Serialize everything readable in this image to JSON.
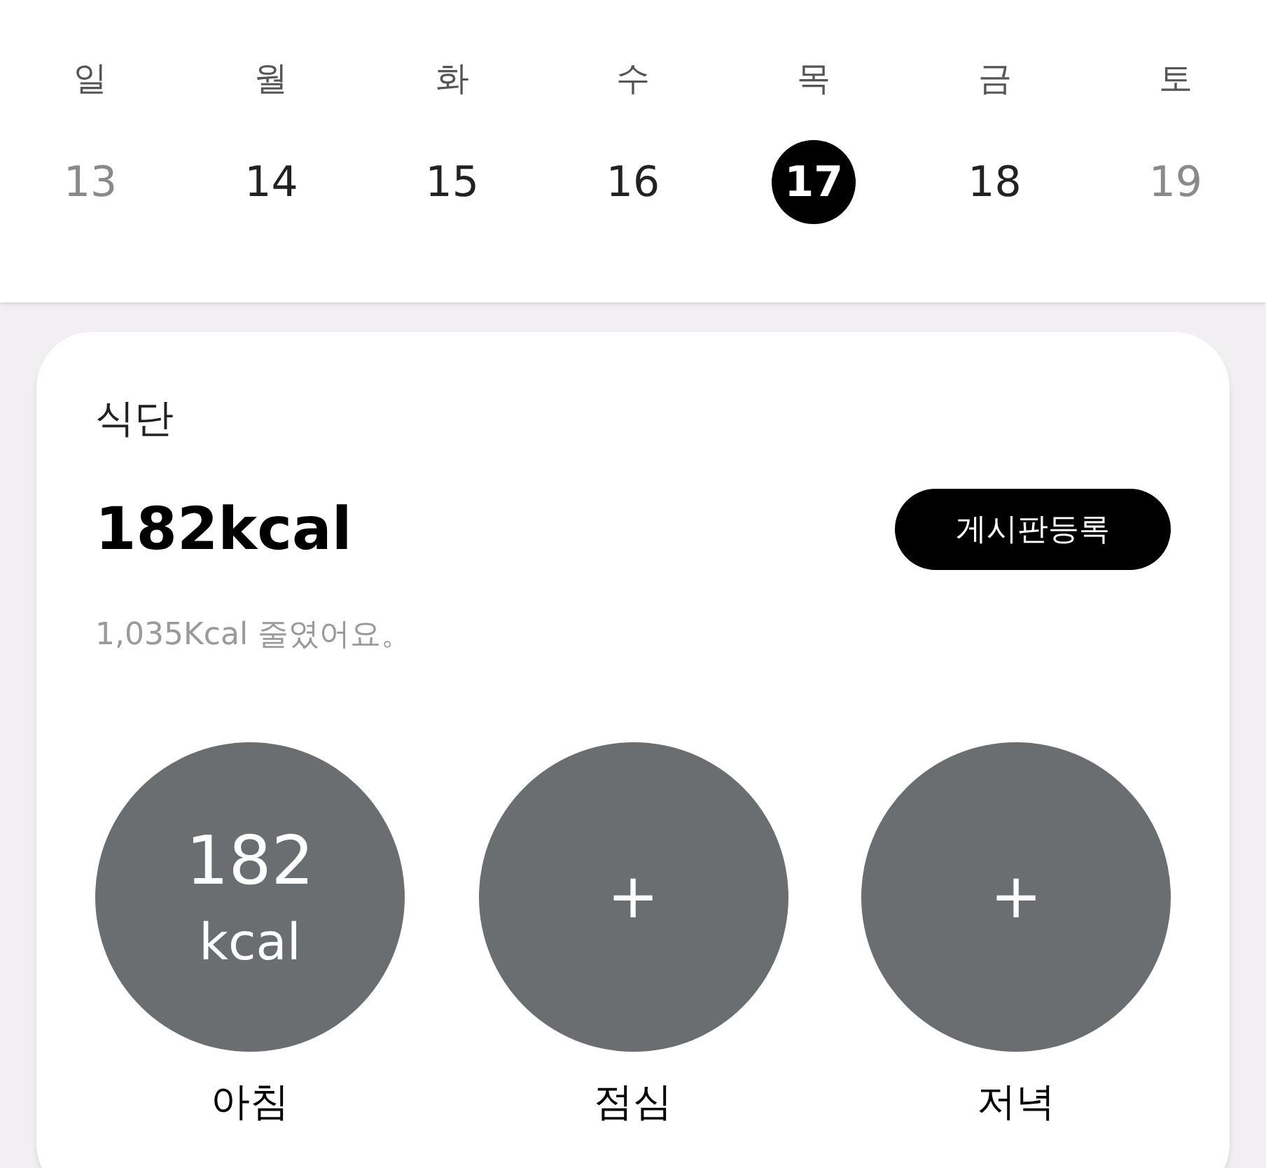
{
  "week": {
    "weekdays": [
      "일",
      "월",
      "화",
      "수",
      "목",
      "금",
      "토"
    ],
    "dates": [
      {
        "label": "13",
        "selected": false,
        "muted": true
      },
      {
        "label": "14",
        "selected": false,
        "muted": false
      },
      {
        "label": "15",
        "selected": false,
        "muted": false
      },
      {
        "label": "16",
        "selected": false,
        "muted": false
      },
      {
        "label": "17",
        "selected": true,
        "muted": false
      },
      {
        "label": "18",
        "selected": false,
        "muted": false
      },
      {
        "label": "19",
        "selected": false,
        "muted": true
      }
    ]
  },
  "diet_card": {
    "title": "식단",
    "total": "182kcal",
    "board_button": "게시판등록",
    "note": "1,035Kcal 줄였어요。",
    "meals": [
      {
        "kind": "logged",
        "value": "182",
        "unit": "kcal",
        "label": "아침"
      },
      {
        "kind": "empty",
        "add": "+",
        "label": "점심"
      },
      {
        "kind": "empty",
        "add": "+",
        "label": "저녁"
      }
    ]
  }
}
